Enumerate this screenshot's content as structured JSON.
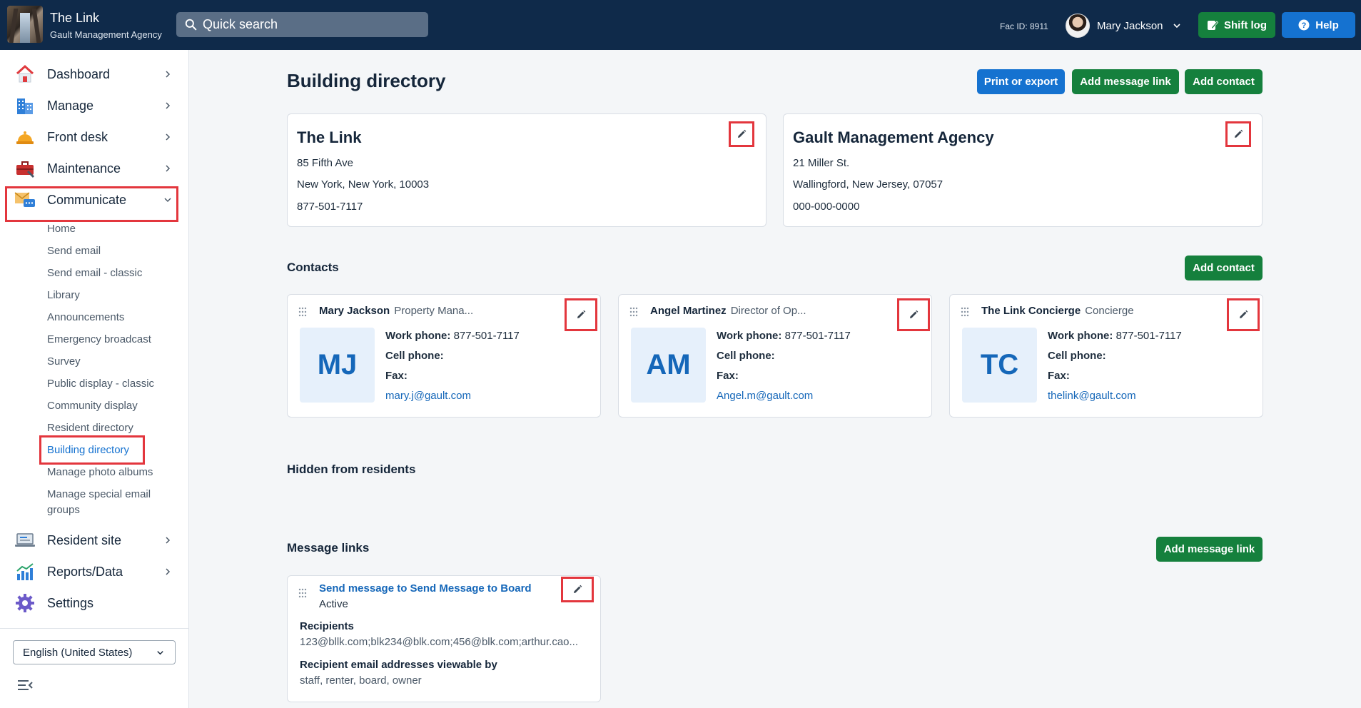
{
  "header": {
    "app_title": "The Link",
    "app_subtitle": "Gault Management Agency",
    "search_placeholder": "Quick search",
    "fac_id": "Fac ID: 8911",
    "user_name": "Mary Jackson",
    "shift_log_label": "Shift log",
    "help_label": "Help"
  },
  "sidebar": {
    "items": [
      {
        "label": "Dashboard",
        "icon": "house-icon"
      },
      {
        "label": "Manage",
        "icon": "building-icon"
      },
      {
        "label": "Front desk",
        "icon": "bell-icon"
      },
      {
        "label": "Maintenance",
        "icon": "toolbox-icon"
      },
      {
        "label": "Communicate",
        "icon": "envelope-chat-icon"
      },
      {
        "label": "Resident site",
        "icon": "laptop-icon"
      },
      {
        "label": "Reports/Data",
        "icon": "chart-icon"
      },
      {
        "label": "Settings",
        "icon": "gear-icon"
      }
    ],
    "sub_items": [
      "Home",
      "Send email",
      "Send email - classic",
      "Library",
      "Announcements",
      "Emergency broadcast",
      "Survey",
      "Public display - classic",
      "Community display",
      "Resident directory",
      "Building directory",
      "Manage photo albums",
      "Manage special email groups"
    ],
    "active_sub_item": "Building directory",
    "language": "English (United States)"
  },
  "main": {
    "title": "Building directory",
    "buttons": {
      "print": "Print or export",
      "add_message_link": "Add message link",
      "add_contact": "Add contact"
    },
    "buildings": [
      {
        "name": "The Link",
        "address1": "85 Fifth Ave",
        "address2": "New York, New York, 10003",
        "phone": "877-501-7117"
      },
      {
        "name": "Gault Management Agency",
        "address1": "21 Miller St.",
        "address2": "Wallingford, New Jersey, 07057",
        "phone": "000-000-0000"
      }
    ],
    "contacts_title": "Contacts",
    "contacts_add_label": "Add contact",
    "contact_labels": {
      "work": "Work phone:",
      "cell": "Cell phone:",
      "fax": "Fax:"
    },
    "contacts": [
      {
        "name": "Mary Jackson",
        "role": "Property Mana...",
        "initials": "MJ",
        "work_phone": "877-501-7117",
        "cell": "",
        "fax": "",
        "email": "mary.j@gault.com"
      },
      {
        "name": "Angel Martinez",
        "role": "Director of Op...",
        "initials": "AM",
        "work_phone": "877-501-7117",
        "cell": "",
        "fax": "",
        "email": "Angel.m@gault.com"
      },
      {
        "name": "The Link Concierge",
        "role": "Concierge",
        "initials": "TC",
        "work_phone": "877-501-7117",
        "cell": "",
        "fax": "",
        "email": "thelink@gault.com"
      }
    ],
    "hidden_title": "Hidden from residents",
    "message_links_title": "Message links",
    "message_links_add_label": "Add message link",
    "message_link": {
      "title": "Send message to Send Message to Board",
      "status": "Active",
      "recipients_label": "Recipients",
      "recipients": "123@bllk.com;blk234@blk.com;456@blk.com;arthur.cao...",
      "viewable_label": "Recipient email addresses viewable by",
      "viewable": "staff, renter, board, owner"
    }
  },
  "colors": {
    "topbar": "#0f2a4a",
    "primary_blue": "#1572d0",
    "primary_green": "#15803d",
    "highlight_red": "#e3363d"
  }
}
